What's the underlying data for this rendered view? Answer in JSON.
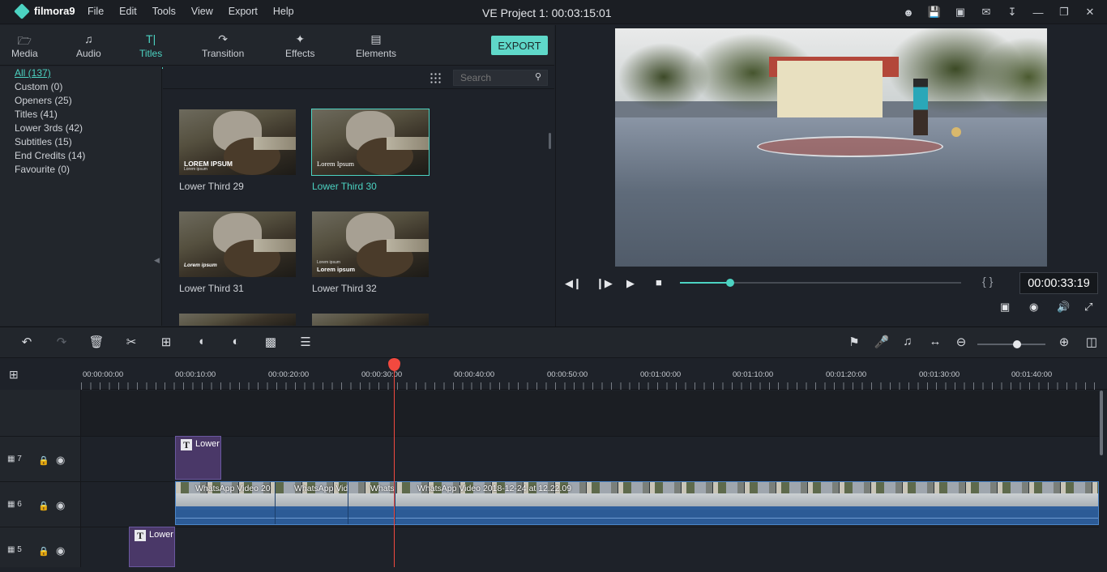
{
  "app": {
    "logo_text": "filmora9",
    "window_title": "VE Project 1:  00:03:15:01"
  },
  "menu": [
    "File",
    "Edit",
    "Tools",
    "View",
    "Export",
    "Help"
  ],
  "window_icons": [
    "account-icon",
    "save-icon",
    "save-as-icon",
    "mail-icon",
    "download-icon",
    "minimize-icon",
    "restore-icon",
    "close-icon"
  ],
  "tabs": [
    {
      "label": "Media",
      "icon": "folder-icon"
    },
    {
      "label": "Audio",
      "icon": "music-note-icon"
    },
    {
      "label": "Titles",
      "icon": "text-icon",
      "active": true
    },
    {
      "label": "Transition",
      "icon": "transition-icon"
    },
    {
      "label": "Effects",
      "icon": "sparkle-icon"
    },
    {
      "label": "Elements",
      "icon": "image-icon"
    }
  ],
  "export_label": "EXPORT",
  "categories": [
    {
      "label": "All (137)",
      "active": true
    },
    {
      "label": "Custom (0)"
    },
    {
      "label": "Openers (25)"
    },
    {
      "label": "Titles (41)"
    },
    {
      "label": "Lower 3rds (42)"
    },
    {
      "label": "Subtitles (15)"
    },
    {
      "label": "End Credits (14)"
    },
    {
      "label": "Favourite (0)"
    }
  ],
  "search": {
    "placeholder": "Search"
  },
  "items": [
    {
      "label": "Lower Third 29",
      "thumb_text": "LOREM IPSUM",
      "thumb_sub": "Lorem ipsum"
    },
    {
      "label": "Lower Third 30",
      "thumb_text": "Lorem Ipsum",
      "thumb_sub": "",
      "selected": true
    },
    {
      "label": "Lower Third 31",
      "thumb_text": "Lorem ipsum",
      "thumb_sub": ""
    },
    {
      "label": "Lower Third 32",
      "thumb_text": "Lorem ipsum",
      "thumb_sub": "Lorem ipsum"
    }
  ],
  "preview": {
    "timecode": "00:00:33:19",
    "progress_fraction": 0.18,
    "braces": "{  }"
  },
  "ruler": [
    "00:00:00:00",
    "00:00:10:00",
    "00:00:20:00",
    "00:00:30:00",
    "00:00:40:00",
    "00:00:50:00",
    "00:01:00:00",
    "00:01:10:00",
    "00:01:20:00",
    "00:01:30:00",
    "00:01:40:00"
  ],
  "tracks": [
    {
      "num": "7"
    },
    {
      "num": "6"
    },
    {
      "num": "5"
    }
  ],
  "clips": {
    "title_a": "Lower",
    "title_b": "Lower",
    "video_labels": [
      "WhatsApp Video 20",
      "WhatsApp Vid",
      "Whats",
      "WhatsApp Video 2018-12-24 at 12.22.09"
    ]
  },
  "zoom_level_fraction": 0.58,
  "colors": {
    "accent": "#4cd3c2",
    "playhead": "#f2493f",
    "title_clip": "#4a3868",
    "video_clip": "#2f5f9c"
  }
}
